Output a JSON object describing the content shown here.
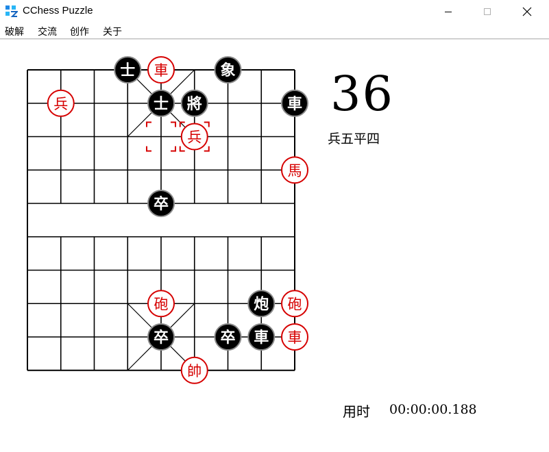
{
  "window": {
    "title": "CChess Puzzle",
    "icon": "cchess-app-icon"
  },
  "menu": {
    "items": [
      "破解",
      "交流",
      "创作",
      "关于"
    ]
  },
  "info": {
    "move_number": "36",
    "last_move": "兵五平四",
    "time_label": "用时",
    "time_value": "00:00:00.188"
  },
  "colors": {
    "red": "#d60000",
    "black": "#000000",
    "board_line": "#000000"
  },
  "board": {
    "files": 9,
    "ranks": 10,
    "selected_from": [
      4,
      2
    ],
    "selected_to": [
      5,
      2
    ],
    "pieces": [
      {
        "label": "士",
        "side": "black",
        "col": 3,
        "row": 0
      },
      {
        "label": "車",
        "side": "red",
        "col": 4,
        "row": 0
      },
      {
        "label": "象",
        "side": "black",
        "col": 6,
        "row": 0
      },
      {
        "label": "兵",
        "side": "red",
        "col": 1,
        "row": 1
      },
      {
        "label": "士",
        "side": "black",
        "col": 4,
        "row": 1
      },
      {
        "label": "將",
        "side": "black",
        "col": 5,
        "row": 1
      },
      {
        "label": "車",
        "side": "black",
        "col": 8,
        "row": 1
      },
      {
        "label": "兵",
        "side": "red",
        "col": 5,
        "row": 2
      },
      {
        "label": "馬",
        "side": "red",
        "col": 8,
        "row": 3
      },
      {
        "label": "卒",
        "side": "black",
        "col": 4,
        "row": 4
      },
      {
        "label": "砲",
        "side": "red",
        "col": 4,
        "row": 7
      },
      {
        "label": "炮",
        "side": "black",
        "col": 7,
        "row": 7
      },
      {
        "label": "砲",
        "side": "red",
        "col": 8,
        "row": 7
      },
      {
        "label": "卒",
        "side": "black",
        "col": 4,
        "row": 8
      },
      {
        "label": "卒",
        "side": "black",
        "col": 6,
        "row": 8
      },
      {
        "label": "車",
        "side": "black",
        "col": 7,
        "row": 8
      },
      {
        "label": "車",
        "side": "red",
        "col": 8,
        "row": 8
      },
      {
        "label": "帥",
        "side": "red",
        "col": 5,
        "row": 9
      }
    ]
  }
}
